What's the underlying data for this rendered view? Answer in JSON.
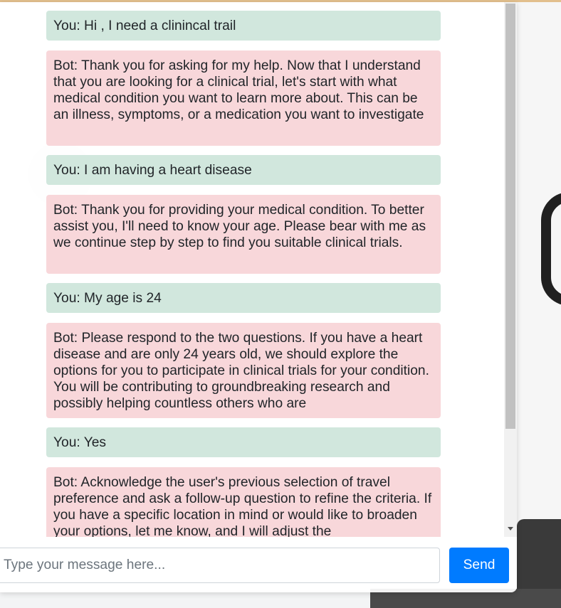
{
  "chat": {
    "messages": [
      {
        "role": "user",
        "text": "You: Hi , I need a clinincal trail"
      },
      {
        "role": "bot",
        "text": "Bot: Thank you for asking for my help. Now that I understand that you are looking for a clinical trial, let's start with what medical condition you want to learn more about. This can be an illness, symptoms, or a medication you want to investigate"
      },
      {
        "role": "user",
        "text": "You: I am having a heart disease"
      },
      {
        "role": "bot",
        "text": "Bot: Thank you for providing your medical condition. To better assist you, I'll need to know your age. Please bear with me as we continue step by step to find you suitable clinical trials."
      },
      {
        "role": "user",
        "text": "You: My age is 24"
      },
      {
        "role": "bot",
        "text": "Bot: Please respond to the two questions. If you have a heart disease and are only 24 years old, we should explore the options for you to participate in clinical trials for your condition. You will be contributing to groundbreaking research and possibly helping countless others who are"
      },
      {
        "role": "user",
        "text": "You: Yes"
      },
      {
        "role": "bot",
        "text": "Bot: Acknowledge the user's previous selection of travel preference and ask a follow-up question to refine the criteria. If you have a specific location in mind or would like to broaden your options, let me know, and I will adjust the"
      }
    ]
  },
  "input": {
    "placeholder": "Type your message here...",
    "value": ""
  },
  "send_label": "Send",
  "colors": {
    "user_bubble": "#d1e7dd",
    "bot_bubble": "#f8d7da",
    "send_button": "#007bff"
  }
}
